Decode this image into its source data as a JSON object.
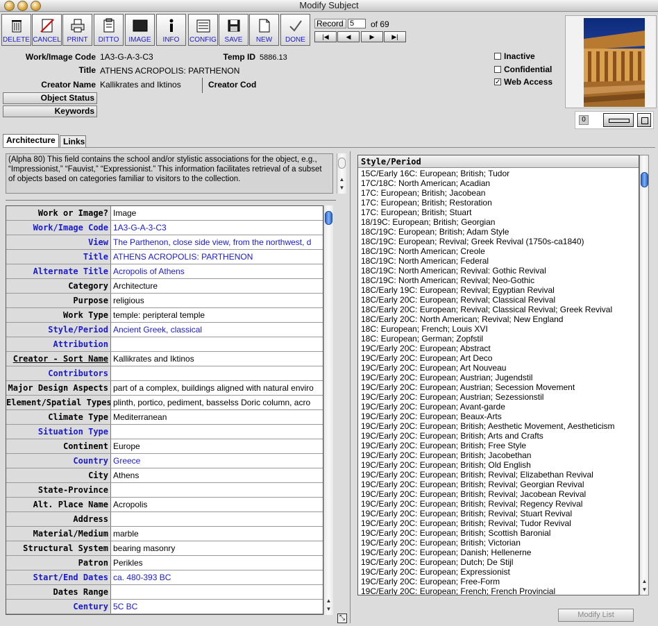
{
  "window": {
    "title": "Modify Subject"
  },
  "toolbar": [
    {
      "icon": "trash-icon",
      "label": "DELETE"
    },
    {
      "icon": "cancel-icon",
      "label": "CANCEL"
    },
    {
      "icon": "printer-icon",
      "label": "PRINT"
    },
    {
      "icon": "ditto-icon",
      "label": "DITTO"
    },
    {
      "icon": "image-icon",
      "label": "IMAGE"
    },
    {
      "icon": "info-icon",
      "label": "INFO"
    },
    {
      "icon": "config-icon",
      "label": "CONFIG"
    },
    {
      "icon": "disk-icon",
      "label": "SAVE"
    },
    {
      "icon": "new-document-icon",
      "label": "NEW"
    },
    {
      "icon": "checkmark-icon",
      "label": "DONE"
    }
  ],
  "record": {
    "label": "Record",
    "value": "5",
    "of_text": "of 69",
    "nav": [
      "|◀",
      "◀",
      "▶",
      "▶|"
    ]
  },
  "header": {
    "work_image_code_label": "Work/Image Code",
    "work_image_code": "1A3-G-A-3-C3",
    "temp_id_label": "Temp ID",
    "temp_id": "5886.13",
    "title_label": "Title",
    "title": "ATHENS ACROPOLIS: PARTHENON",
    "creator_name_label": "Creator Name",
    "creator_name": "Kallikrates and Iktinos",
    "creator_code_label": "Creator Cod",
    "object_status_label": "Object Status",
    "keywords_label": "Keywords"
  },
  "flags": [
    {
      "label": "Inactive",
      "checked": false
    },
    {
      "label": "Confidential",
      "checked": false
    },
    {
      "label": "Web Access",
      "checked": true
    }
  ],
  "thumbnail": {
    "counter": "0"
  },
  "tabs": [
    {
      "label": "Architecture",
      "active": true
    },
    {
      "label": "Links",
      "active": false
    }
  ],
  "help_text": "(Alpha 80) This field contains the school and/or stylistic associations for the object, e.g., “Impressionist,” “Fauvist,” “Expressionist.” This information facilitates retrieval of a subset of objects based on categories familiar to visitors to the collection.",
  "fields": [
    {
      "label": "Work or Image?",
      "value": "Image",
      "style": "plain"
    },
    {
      "label": "Work/Image Code",
      "value": "1A3-G-A-3-C3",
      "style": "blue"
    },
    {
      "label": "View",
      "value": "The Parthenon,  close side view, from the northwest, d",
      "style": "blue"
    },
    {
      "label": "Title",
      "value": "ATHENS ACROPOLIS: PARTHENON",
      "style": "blue"
    },
    {
      "label": "Alternate Title",
      "value": "Acropolis of Athens",
      "style": "blue"
    },
    {
      "label": "Category",
      "value": "Architecture",
      "style": "plain"
    },
    {
      "label": "Purpose",
      "value": "religious",
      "style": "plain"
    },
    {
      "label": "Work Type",
      "value": "temple: peripteral temple",
      "style": "plain"
    },
    {
      "label": "Style/Period",
      "value": "Ancient Greek, classical",
      "style": "blue"
    },
    {
      "label": "Attribution",
      "value": "",
      "style": "blue"
    },
    {
      "label": "Creator - Sort Name",
      "value": "Kallikrates and Iktinos",
      "style": "underline"
    },
    {
      "label": "Contributors",
      "value": "",
      "style": "blue"
    },
    {
      "label": "Major Design Aspects",
      "value": "part of a complex, buildings aligned with natural enviro",
      "style": "plain"
    },
    {
      "label": "Element/Spatial Types",
      "value": "plinth, portico, pediment, basselss Doric column, acro",
      "style": "plain"
    },
    {
      "label": "Climate Type",
      "value": "Mediterranean",
      "style": "plain"
    },
    {
      "label": "Situation Type",
      "value": "",
      "style": "blue"
    },
    {
      "label": "Continent",
      "value": "Europe",
      "style": "plain"
    },
    {
      "label": "Country",
      "value": "Greece",
      "style": "blue"
    },
    {
      "label": "City",
      "value": "Athens",
      "style": "plain"
    },
    {
      "label": "State-Province",
      "value": "",
      "style": "plain"
    },
    {
      "label": "Alt. Place Name",
      "value": "Acropolis",
      "style": "plain"
    },
    {
      "label": "Address",
      "value": "",
      "style": "plain"
    },
    {
      "label": "Material/Medium",
      "value": "marble",
      "style": "plain"
    },
    {
      "label": "Structural System",
      "value": "bearing masonry",
      "style": "plain"
    },
    {
      "label": "Patron",
      "value": "Perikles",
      "style": "plain"
    },
    {
      "label": "Start/End Dates",
      "value": "ca. 480-393 BC",
      "style": "blue"
    },
    {
      "label": "Dates Range",
      "value": "",
      "style": "plain"
    },
    {
      "label": "Century",
      "value": "5C BC",
      "style": "blue"
    }
  ],
  "style_list": {
    "header": "Style/Period",
    "items": [
      "15C/Early 16C: European; British; Tudor",
      "17C/18C: North American; Acadian",
      "17C: European; British; Jacobean",
      "17C: European; British; Restoration",
      "17C: European; British; Stuart",
      "18/19C: European; British; Georgian",
      "18C/19C: European; British; Adam Style",
      "18C/19C: European; Revival; Greek Revival (1750s-ca1840)",
      "18C/19C: North American; Creole",
      "18C/19C: North American; Federal",
      "18C/19C: North American; Revival: Gothic Revival",
      "18C/19C: North American; Revival; Neo-Gothic",
      "18C/Early 19C: European; Revival; Egyptian Revival",
      "18C/Early 20C: European; Revival; Classical Revival",
      "18C/Early 20C: European; Revival; Classical Revival; Greek Revival",
      "18C/Early 20C: North American; Revival; New England",
      "18C: European; French; Louis XVI",
      "18C: European; German; Zopfstil",
      "19C/Early 20C: European; Abstract",
      "19C/Early 20C: European; Art Deco",
      "19C/Early 20C: European; Art Nouveau",
      "19C/Early 20C: European; Austrian; Jugendstil",
      "19C/Early 20C: European; Austrian; Secession Movement",
      "19C/Early 20C: European; Austrian; Sezessionstil",
      "19C/Early 20C: European; Avant-garde",
      "19C/Early 20C: European; Beaux-Arts",
      "19C/Early 20C: European; British; Aesthetic Movement, Aestheticism",
      "19C/Early 20C: European; British; Arts and Crafts",
      "19C/Early 20C: European; British; Free Style",
      "19C/Early 20C: European; British; Jacobethan",
      "19C/Early 20C: European; British; Old English",
      "19C/Early 20C: European; British; Revival; Elizabethan Revival",
      "19C/Early 20C: European; British; Revival; Georgian Revival",
      "19C/Early 20C: European; British; Revival; Jacobean Revival",
      "19C/Early 20C: European; British; Revival; Regency Revival",
      "19C/Early 20C: European; British; Revival; Stuart Revival",
      "19C/Early 20C: European; British; Revival; Tudor Revival",
      "19C/Early 20C: European; British; Scottish Baronial",
      "19C/Early 20C: European; British; Victorian",
      "19C/Early 20C: European; Danish; Hellenerne",
      "19C/Early 20C: European; Dutch; De Stijl",
      "19C/Early 20C: European; Expressionist",
      "19C/Early 20C: European; Free-Form",
      "19C/Early 20C: European; French; French Provincial"
    ]
  },
  "modify_list_label": "Modify List",
  "colors": {
    "link_blue": "#1a1ad0",
    "scroll_thumb": "#2a66c8",
    "panel_gray": "#dcdcdc"
  }
}
